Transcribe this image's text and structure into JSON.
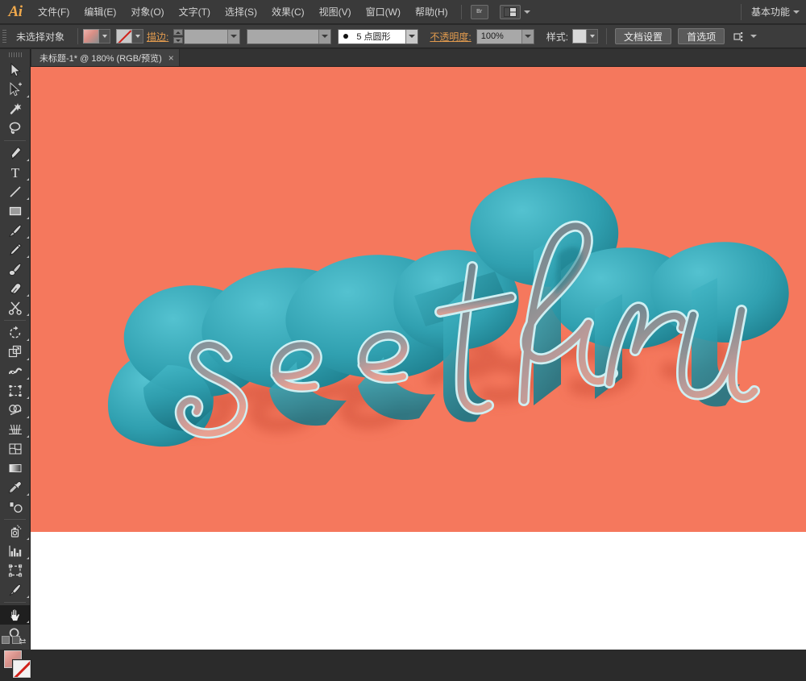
{
  "app": {
    "name": "Adobe Illustrator",
    "logo_text": "Ai"
  },
  "menubar": {
    "items": [
      {
        "label": "文件(F)",
        "name": "menu-file"
      },
      {
        "label": "编辑(E)",
        "name": "menu-edit"
      },
      {
        "label": "对象(O)",
        "name": "menu-object"
      },
      {
        "label": "文字(T)",
        "name": "menu-type"
      },
      {
        "label": "选择(S)",
        "name": "menu-select"
      },
      {
        "label": "效果(C)",
        "name": "menu-effect"
      },
      {
        "label": "视图(V)",
        "name": "menu-view"
      },
      {
        "label": "窗口(W)",
        "name": "menu-window"
      },
      {
        "label": "帮助(H)",
        "name": "menu-help"
      }
    ],
    "bridge_button": "Br",
    "arrange_documents_icon": "arrange-documents-icon",
    "workspace": "基本功能"
  },
  "controlbar": {
    "selection_status": "未选择对象",
    "fill_swatch": "gradient-fill-swatch",
    "stroke_swatch": "none-stroke-swatch",
    "stroke_link_label": "描边:",
    "stroke_weight_value": "",
    "stroke_profile_value": "",
    "brush_definition_value": "5 点圆形",
    "opacity_label": "不透明度:",
    "opacity_value": "100%",
    "style_label": "样式:",
    "document_setup_button": "文档设置",
    "preferences_button": "首选项",
    "transform_icon": "transform-handles-icon"
  },
  "tabbar": {
    "document_tab": "未标题-1* @ 180% (RGB/预览)",
    "close_glyph": "×"
  },
  "toolbar": {
    "groups": [
      [
        {
          "name": "selection-tool",
          "title": "选择工具",
          "has_flyout": false
        },
        {
          "name": "direct-selection-tool",
          "title": "直接选择工具",
          "has_flyout": true
        },
        {
          "name": "magic-wand-tool",
          "title": "魔棒工具",
          "has_flyout": false
        },
        {
          "name": "lasso-tool",
          "title": "套索工具",
          "has_flyout": false
        }
      ],
      [
        {
          "name": "pen-tool",
          "title": "钢笔工具",
          "has_flyout": true
        },
        {
          "name": "type-tool",
          "title": "文字工具",
          "has_flyout": true
        },
        {
          "name": "line-segment-tool",
          "title": "直线段工具",
          "has_flyout": true
        },
        {
          "name": "rectangle-tool",
          "title": "矩形工具",
          "has_flyout": true
        },
        {
          "name": "paintbrush-tool",
          "title": "画笔工具",
          "has_flyout": true
        },
        {
          "name": "pencil-tool",
          "title": "铅笔工具",
          "has_flyout": true
        },
        {
          "name": "blob-brush-tool",
          "title": "斑点画笔工具",
          "has_flyout": false
        },
        {
          "name": "eraser-tool",
          "title": "橡皮擦工具",
          "has_flyout": true
        },
        {
          "name": "scissors-tool",
          "title": "剪刀工具",
          "has_flyout": true
        }
      ],
      [
        {
          "name": "rotate-tool",
          "title": "旋转工具",
          "has_flyout": true
        },
        {
          "name": "scale-tool",
          "title": "比例缩放工具",
          "has_flyout": true
        },
        {
          "name": "width-tool",
          "title": "宽度工具",
          "has_flyout": true
        },
        {
          "name": "free-transform-tool",
          "title": "自由变换工具",
          "has_flyout": false
        },
        {
          "name": "shape-builder-tool",
          "title": "形状生成器工具",
          "has_flyout": true
        },
        {
          "name": "perspective-grid-tool",
          "title": "透视网格工具",
          "has_flyout": true
        },
        {
          "name": "mesh-tool",
          "title": "网格工具",
          "has_flyout": false
        },
        {
          "name": "gradient-tool",
          "title": "渐变工具",
          "has_flyout": false
        },
        {
          "name": "eyedropper-tool",
          "title": "吸管工具",
          "has_flyout": true
        },
        {
          "name": "blend-tool",
          "title": "混合工具",
          "has_flyout": false
        }
      ],
      [
        {
          "name": "symbol-sprayer-tool",
          "title": "符号喷枪工具",
          "has_flyout": true
        },
        {
          "name": "column-graph-tool",
          "title": "柱形图工具",
          "has_flyout": true
        },
        {
          "name": "artboard-tool",
          "title": "画板工具",
          "has_flyout": false
        },
        {
          "name": "slice-tool",
          "title": "切片工具",
          "has_flyout": true
        }
      ],
      [
        {
          "name": "hand-tool",
          "title": "抓手工具",
          "has_flyout": true,
          "active": true
        },
        {
          "name": "zoom-tool",
          "title": "缩放工具",
          "has_flyout": false
        }
      ]
    ],
    "fill_stroke": {
      "fill_name": "fill-color-swatch",
      "stroke_name": "stroke-color-swatch",
      "swap_name": "swap-fill-stroke-icon",
      "default_name": "default-fill-stroke-icon"
    }
  },
  "artwork": {
    "text_line1": "see",
    "text_line2": "thru",
    "background_color": "#F5785D",
    "shadow_color": "#E0604A",
    "teal_light": "#3FB3C4",
    "teal_mid": "#2A96A6",
    "teal_dark": "#1E7C8A",
    "outline_color": "#CFEFF2",
    "face_highlight": "#C9A8A8",
    "face_gray": "#8E9295"
  },
  "canvas": {
    "background_color": "#FFFFFF",
    "zoom_level": "180%"
  }
}
